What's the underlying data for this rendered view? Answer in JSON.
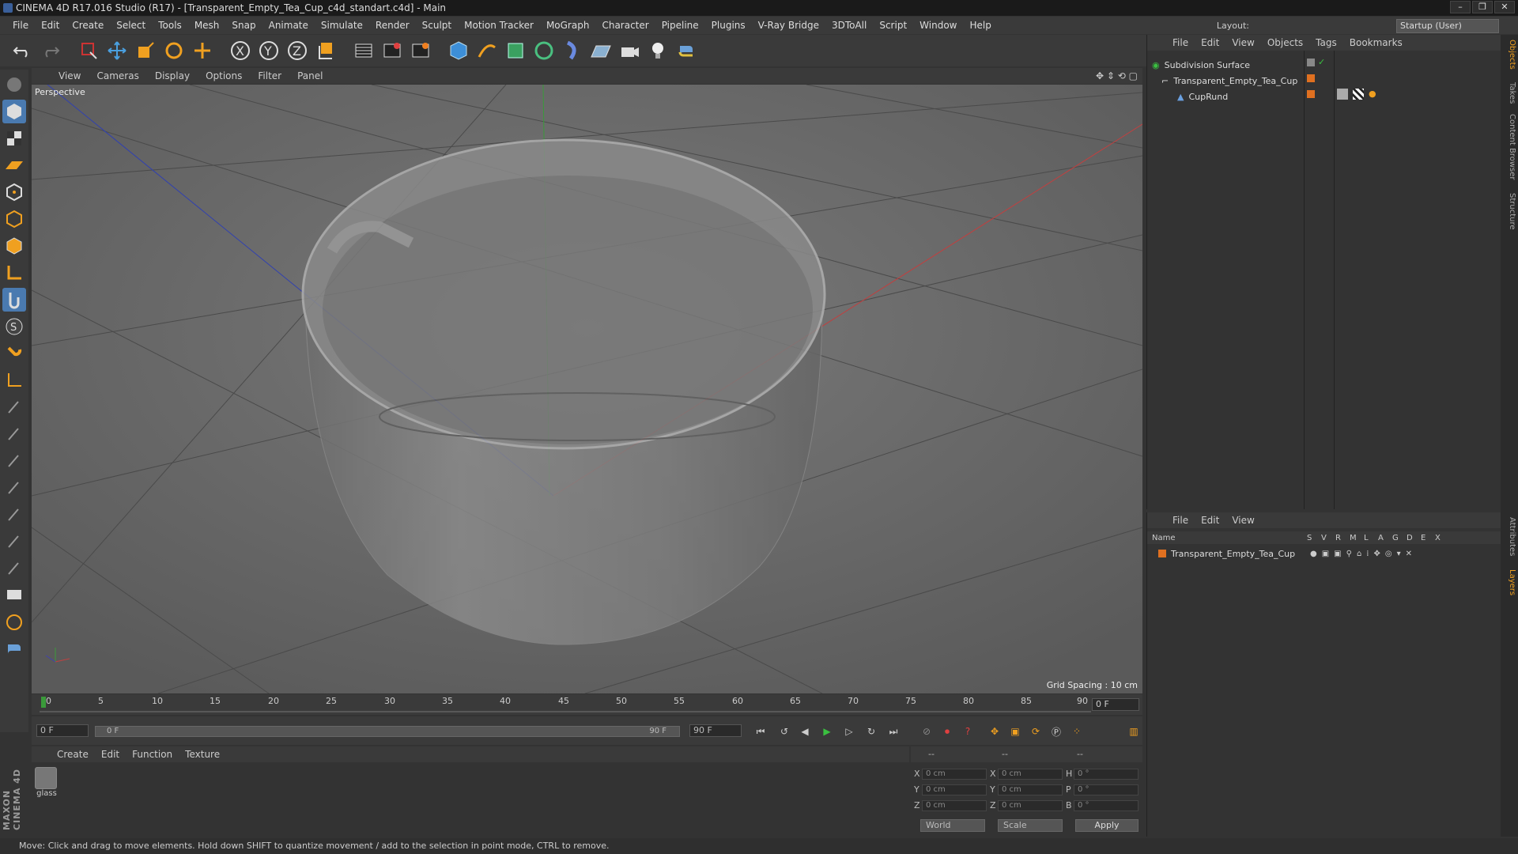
{
  "window": {
    "title": "CINEMA 4D R17.016 Studio (R17) - [Transparent_Empty_Tea_Cup_c4d_standart.c4d] - Main",
    "controls": [
      "–",
      "❐",
      "✕"
    ]
  },
  "menubar": [
    "File",
    "Edit",
    "Create",
    "Select",
    "Tools",
    "Mesh",
    "Snap",
    "Animate",
    "Simulate",
    "Render",
    "Sculpt",
    "Motion Tracker",
    "MoGraph",
    "Character",
    "Pipeline",
    "Plugins",
    "V-Ray Bridge",
    "3DToAll",
    "Script",
    "Window",
    "Help"
  ],
  "layout": {
    "label": "Layout:",
    "value": "Startup (User)"
  },
  "toolbar_icons": [
    "undo-icon",
    "redo-icon",
    "live-selection-icon",
    "move-icon",
    "scale-icon",
    "rotate-icon",
    "move-add-icon",
    "x-axis-icon",
    "y-axis-icon",
    "z-axis-icon",
    "coordinate-system-icon",
    "render-view-icon",
    "render-picture-viewer-icon",
    "edit-render-settings-icon",
    "cube-icon",
    "pen-icon",
    "subdivision-icon",
    "array-icon",
    "deformer-icon",
    "floor-icon",
    "camera-icon",
    "light-icon",
    "python-icon"
  ],
  "viewport": {
    "menu": [
      "View",
      "Cameras",
      "Display",
      "Options",
      "Filter",
      "Panel"
    ],
    "label": "Perspective",
    "grid_spacing": "Grid Spacing : 10 cm"
  },
  "timeline": {
    "ticks": [
      "0",
      "5",
      "10",
      "15",
      "20",
      "25",
      "30",
      "35",
      "40",
      "45",
      "50",
      "55",
      "60",
      "65",
      "70",
      "75",
      "80",
      "85",
      "90"
    ],
    "current_frame": "0 F",
    "start": "0 F",
    "slider_start": "0 F",
    "slider_end": "90 F",
    "end": "90 F"
  },
  "material_manager": {
    "menu": [
      "Create",
      "Edit",
      "Function",
      "Texture"
    ],
    "materials": [
      {
        "name": "glass"
      }
    ]
  },
  "coordinates": {
    "headers": [
      "--",
      "--",
      "--"
    ],
    "rows": [
      {
        "a": "X",
        "av": "0 cm",
        "b": "X",
        "bv": "0 cm",
        "c": "H",
        "cv": "0 °"
      },
      {
        "a": "Y",
        "av": "0 cm",
        "b": "Y",
        "bv": "0 cm",
        "c": "P",
        "cv": "0 °"
      },
      {
        "a": "Z",
        "av": "0 cm",
        "b": "Z",
        "bv": "0 cm",
        "c": "B",
        "cv": "0 °"
      }
    ],
    "space": "World",
    "mode": "Scale",
    "apply": "Apply"
  },
  "object_manager": {
    "menu": [
      "File",
      "Edit",
      "View",
      "Objects",
      "Tags",
      "Bookmarks"
    ],
    "objects": [
      {
        "name": "Subdivision Surface",
        "indent": 0
      },
      {
        "name": "Transparent_Empty_Tea_Cup",
        "indent": 1
      },
      {
        "name": "CupRund",
        "indent": 2
      }
    ]
  },
  "layer_manager": {
    "menu": [
      "File",
      "Edit",
      "View"
    ],
    "columns": [
      "Name",
      "S",
      "V",
      "R",
      "M",
      "L",
      "A",
      "G",
      "D",
      "E",
      "X"
    ],
    "layers": [
      {
        "name": "Transparent_Empty_Tea_Cup",
        "color": "#e07020"
      }
    ]
  },
  "side_tabs": [
    "Objects",
    "Takes",
    "Content Browser",
    "Structure",
    "Attributes",
    "Layers"
  ],
  "status": "Move: Click and drag to move elements. Hold down SHIFT to quantize movement / add to the selection in point mode, CTRL to remove.",
  "brand": "MAXON CINEMA 4D",
  "colors": {
    "accent": "#f0a020",
    "axis_x": "#c04040",
    "axis_y": "#3a9a3a",
    "axis_z": "#4040b0",
    "layer": "#e07020"
  }
}
